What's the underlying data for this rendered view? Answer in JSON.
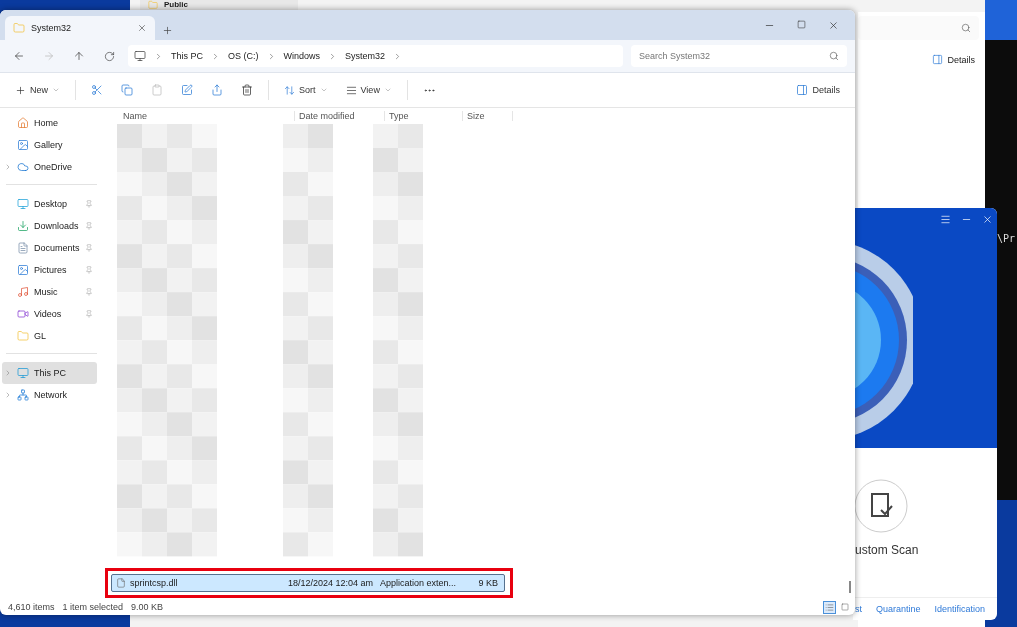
{
  "background_explorer": {
    "tab": {
      "title": "Public"
    },
    "details_label": "Details"
  },
  "terminal": {
    "text": "\\Pr"
  },
  "explorer": {
    "tab": {
      "title": "System32"
    },
    "breadcrumbs": [
      "This PC",
      "OS (C:)",
      "Windows",
      "System32"
    ],
    "search": {
      "placeholder": "Search System32"
    },
    "toolbar": {
      "new_label": "New",
      "sort_label": "Sort",
      "view_label": "View",
      "details_label": "Details"
    },
    "sidebar": [
      [
        {
          "label": "Home",
          "expandable": false,
          "pinned": false,
          "selected": false
        },
        {
          "label": "Gallery",
          "expandable": false,
          "pinned": false,
          "selected": false
        },
        {
          "label": "OneDrive",
          "expandable": true,
          "pinned": false,
          "selected": false
        }
      ],
      [
        {
          "label": "Desktop",
          "expandable": false,
          "pinned": true,
          "selected": false
        },
        {
          "label": "Downloads",
          "expandable": false,
          "pinned": true,
          "selected": false
        },
        {
          "label": "Documents",
          "expandable": false,
          "pinned": true,
          "selected": false
        },
        {
          "label": "Pictures",
          "expandable": false,
          "pinned": true,
          "selected": false
        },
        {
          "label": "Music",
          "expandable": false,
          "pinned": true,
          "selected": false
        },
        {
          "label": "Videos",
          "expandable": false,
          "pinned": true,
          "selected": false
        },
        {
          "label": "GL",
          "expandable": false,
          "pinned": false,
          "selected": false
        }
      ],
      [
        {
          "label": "This PC",
          "expandable": true,
          "pinned": false,
          "selected": true
        },
        {
          "label": "Network",
          "expandable": true,
          "pinned": false,
          "selected": false
        }
      ]
    ],
    "columns": [
      "Name",
      "Date modified",
      "Type",
      "Size"
    ],
    "selected_file": {
      "name": "sprintcsp.dll",
      "date_modified": "18/12/2024 12:04 am",
      "type": "Application exten...",
      "size": "9 KB",
      "selected": true,
      "highlighted": true
    },
    "status_bar": {
      "item_count": "4,610 items",
      "selection": "1 item selected",
      "selection_size": "9.00 KB"
    },
    "view_buttons": [
      {
        "selected": true
      },
      {
        "selected": false
      }
    ]
  },
  "antivirus": {
    "feature_label": "ustom Scan",
    "links": [
      "st",
      "Quarantine",
      "Identification"
    ]
  }
}
